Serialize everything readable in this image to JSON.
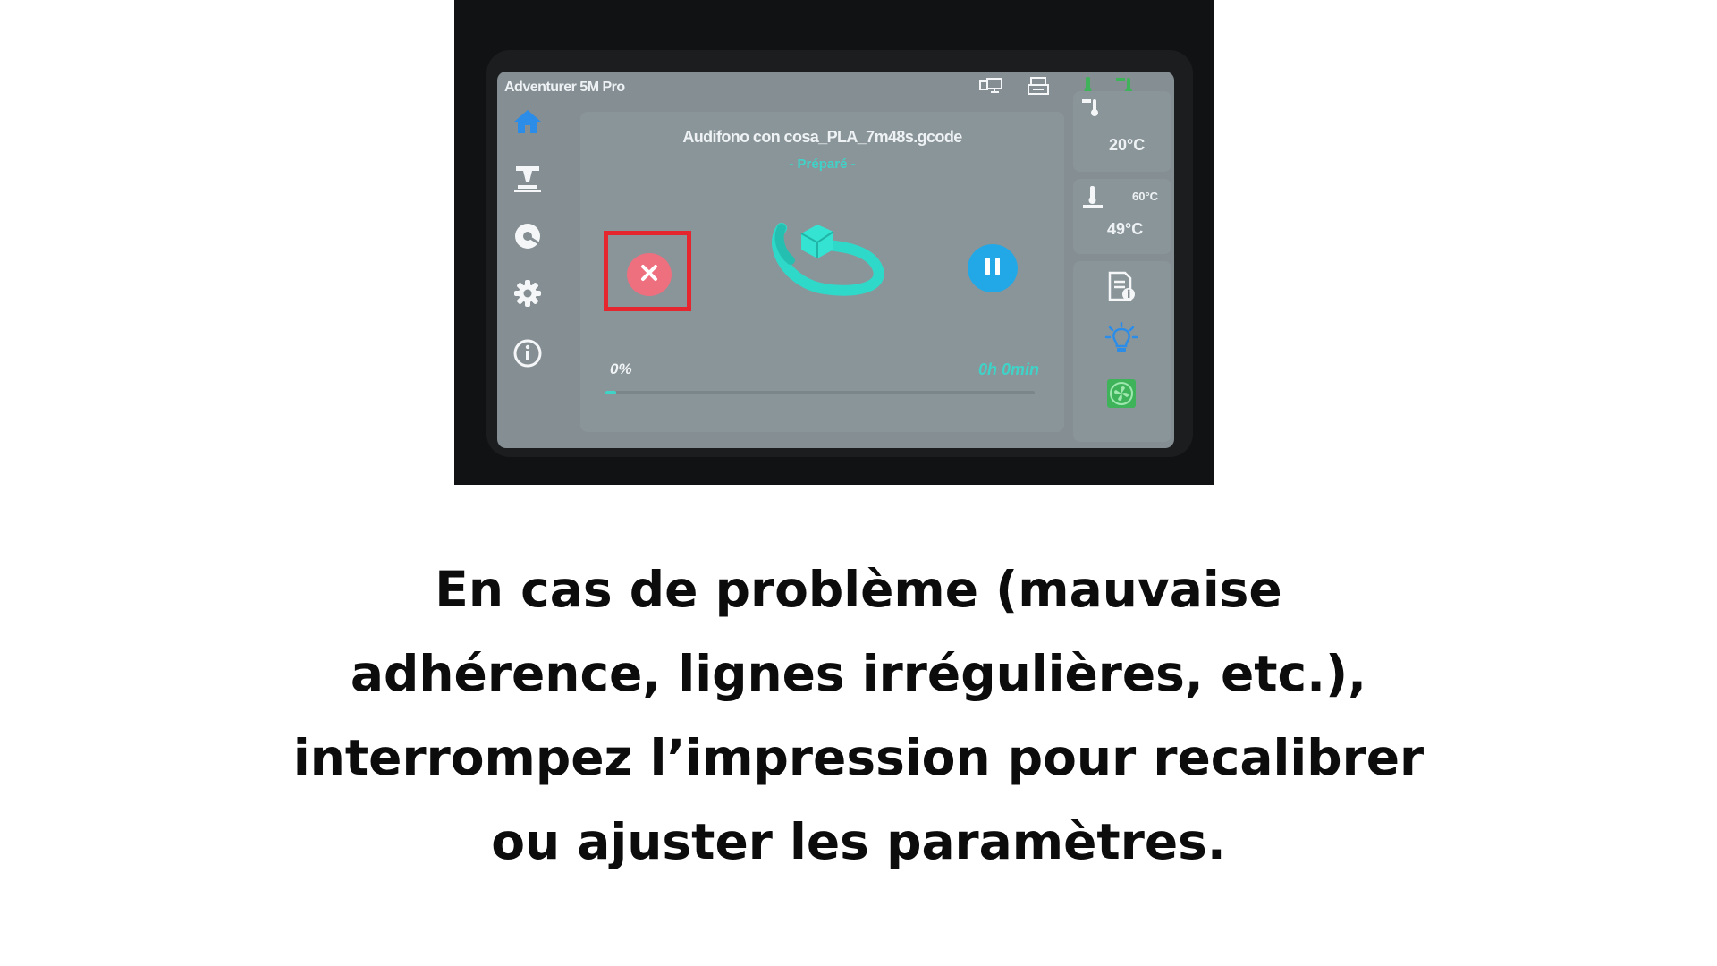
{
  "printer": {
    "title": "Adventurer 5M Pro",
    "top_icons": [
      "network-icon",
      "printer-icon",
      "bed-temperature-icon",
      "nozzle-temperature-icon"
    ],
    "nav": [
      "home-icon",
      "print-bed-icon",
      "filament-spool-icon",
      "gear-icon",
      "info-icon"
    ],
    "job": {
      "file_name": "Audifono con cosa_PLA_7m48s.gcode",
      "status": "- Préparé -",
      "progress_label": "0%",
      "progress": 0,
      "time_remaining": "0h 0min"
    },
    "nozzle": {
      "current": "20°C"
    },
    "bed": {
      "target": "60°C",
      "current": "49°C"
    },
    "side_buttons": [
      "file-details-icon",
      "light-bulb-icon",
      "fan-icon"
    ],
    "colors": {
      "accent_teal": "#3fd3c8",
      "pause_blue": "#22a8e6",
      "cancel_red": "#ee6f7e",
      "highlight_red": "#e5262e",
      "fan_green": "#3fb35a"
    }
  },
  "caption": {
    "line1": "En cas de problème (mauvaise",
    "line2": "adhérence, lignes irrégulières, etc.),",
    "line3": "interrompez l’impression pour recalibrer",
    "line4": "ou ajuster les paramètres."
  }
}
